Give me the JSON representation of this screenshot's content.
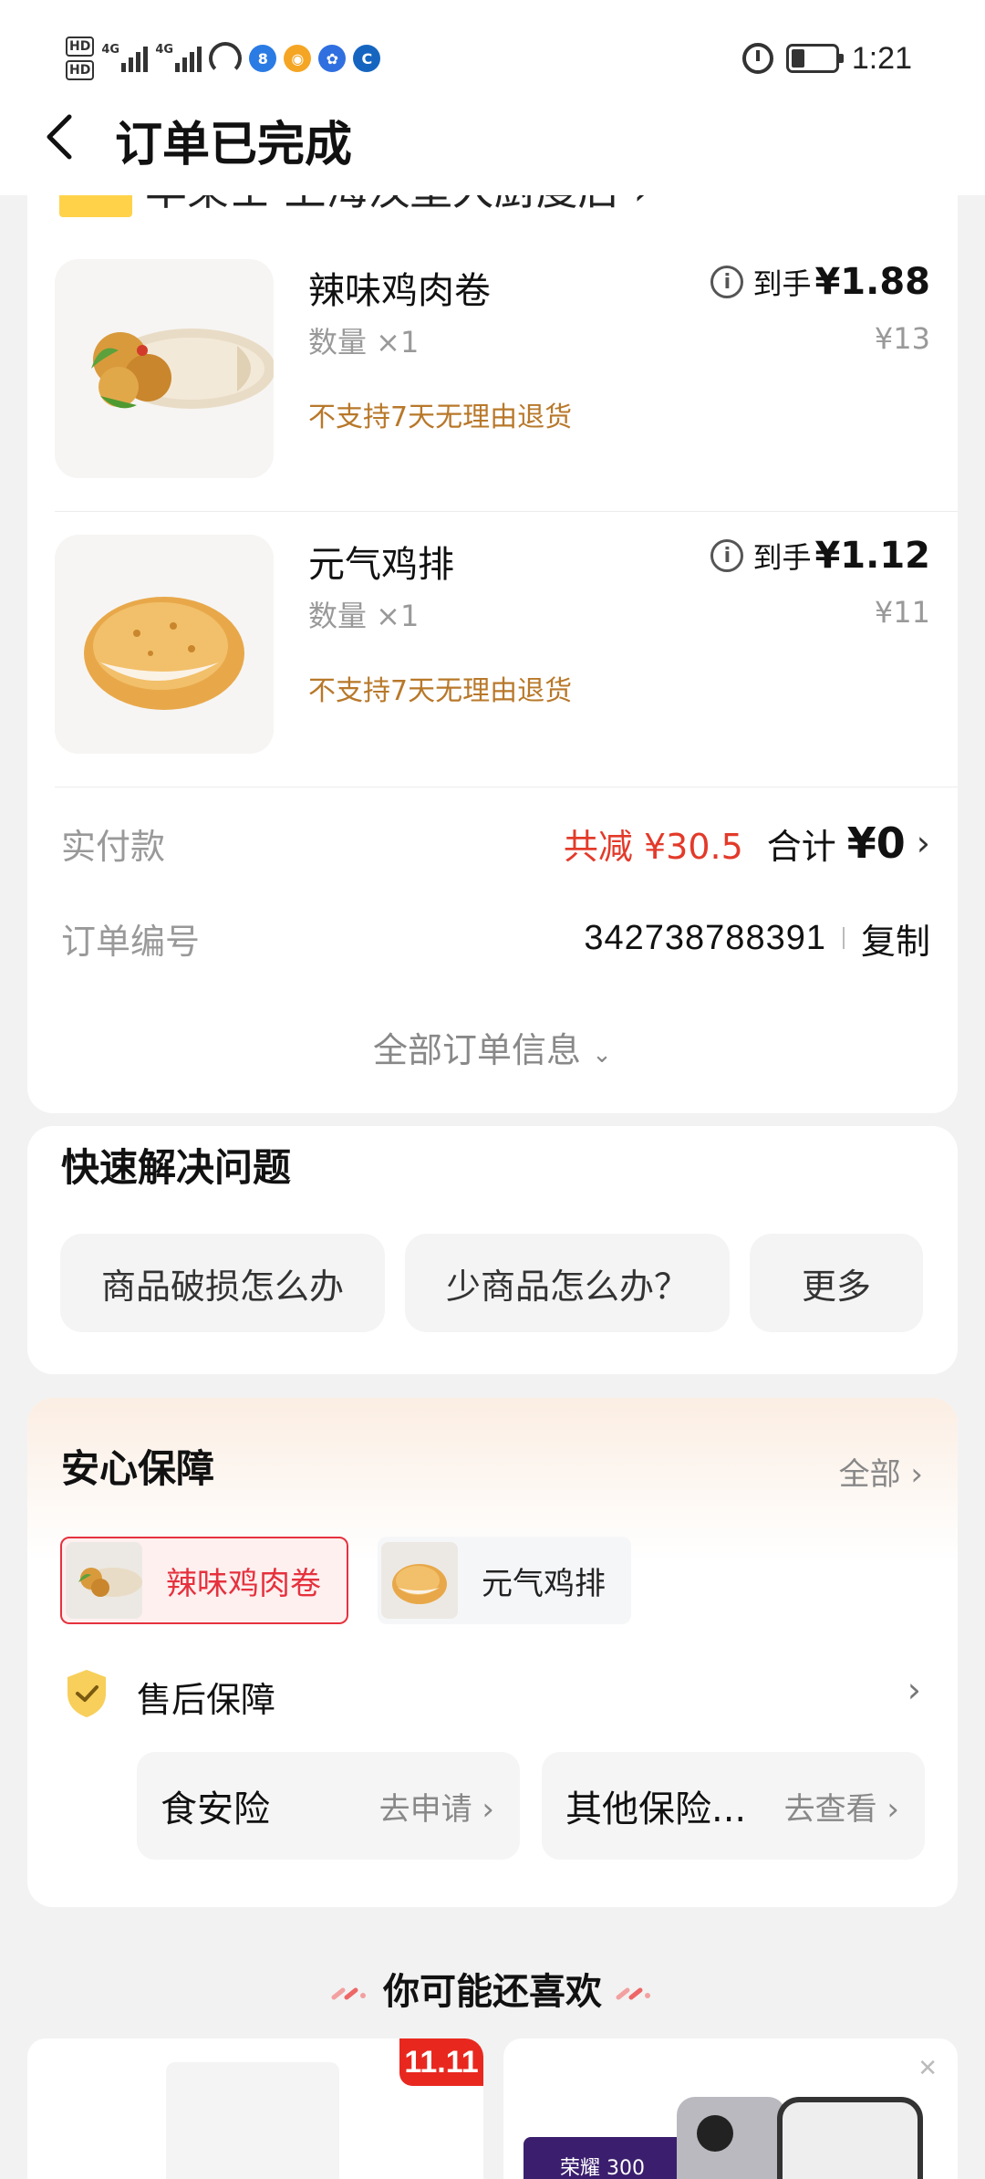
{
  "status_bar": {
    "hd1": "HD",
    "hd2": "HD",
    "net1": "4G",
    "net2": "4G",
    "time": "1:21"
  },
  "header": {
    "title": "订单已完成"
  },
  "store": {
    "name_peek": "华莱士·上海汉堡大厨度店 ›"
  },
  "items": [
    {
      "name": "辣味鸡肉卷",
      "qty": "数量 ×1",
      "policy": "不支持7天无理由退货",
      "price_label": "到手",
      "price": "¥1.88",
      "original_price": "¥13"
    },
    {
      "name": "元气鸡排",
      "qty": "数量 ×1",
      "policy": "不支持7天无理由退货",
      "price_label": "到手",
      "price": "¥1.12",
      "original_price": "¥11"
    }
  ],
  "payment": {
    "label": "实付款",
    "discount": "共减 ¥30.5",
    "total_label": "合计",
    "total": "¥0"
  },
  "order_number": {
    "label": "订单编号",
    "value": "342738788391",
    "copy": "复制"
  },
  "all_order_info": "全部订单信息",
  "quick_solve": {
    "title": "快速解决问题",
    "chips": [
      "商品破损怎么办",
      "少商品怎么办？",
      "更多"
    ]
  },
  "assurance": {
    "title": "安心保障",
    "all": "全部",
    "tabs": [
      "辣味鸡肉卷",
      "元气鸡排"
    ],
    "aftersale": "售后保障",
    "insurances": [
      {
        "name": "食安险",
        "action": "去申请"
      },
      {
        "name": "其他保险...",
        "action": "去查看"
      }
    ]
  },
  "recommend": {
    "title": "你可能还喜欢",
    "badge": "11.11",
    "ad_tag": "荣耀 300"
  },
  "colors": {
    "accent_red": "#e33a2a",
    "policy_brown": "#b8782a",
    "tab_active": "#e5323e"
  }
}
